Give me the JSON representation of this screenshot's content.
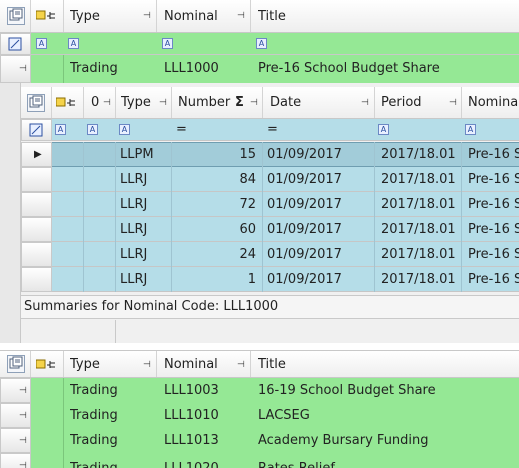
{
  "outer_header": {
    "col_type": "Type",
    "col_nominal": "Nominal",
    "col_title": "Title"
  },
  "filter_icon_letter": "A",
  "group_row": {
    "type": "Trading",
    "nominal": "LLL1000",
    "title": "Pre-16 School Budget Share"
  },
  "inner_header": {
    "col_zero": "0",
    "col_type": "Type",
    "col_number": "Number",
    "sigma": "Σ",
    "col_date": "Date",
    "col_period": "Period",
    "col_nominal": "Nomina"
  },
  "inner_filter_eq": "=",
  "inner_rows": [
    {
      "type": "LLPM",
      "number": "15",
      "date": "01/09/2017",
      "period": "2017/18.01",
      "nominal": "Pre-16 S",
      "current": true
    },
    {
      "type": "LLRJ",
      "number": "84",
      "date": "01/09/2017",
      "period": "2017/18.01",
      "nominal": "Pre-16 S",
      "current": false
    },
    {
      "type": "LLRJ",
      "number": "72",
      "date": "01/09/2017",
      "period": "2017/18.01",
      "nominal": "Pre-16 S",
      "current": false
    },
    {
      "type": "LLRJ",
      "number": "60",
      "date": "01/09/2017",
      "period": "2017/18.01",
      "nominal": "Pre-16 S",
      "current": false
    },
    {
      "type": "LLRJ",
      "number": "24",
      "date": "01/09/2017",
      "period": "2017/18.01",
      "nominal": "Pre-16 S",
      "current": false
    },
    {
      "type": "LLRJ",
      "number": "1",
      "date": "01/09/2017",
      "period": "2017/18.01",
      "nominal": "Pre-16 S",
      "current": false
    }
  ],
  "summary_text": "Summaries for Nominal Code: LLL1000",
  "second_header": {
    "col_type": "Type",
    "col_nominal": "Nominal",
    "col_title": "Title"
  },
  "second_rows": [
    {
      "type": "Trading",
      "nominal": "LLL1003",
      "title": "16-19 School Budget Share"
    },
    {
      "type": "Trading",
      "nominal": "LLL1010",
      "title": "LACSEG"
    },
    {
      "type": "Trading",
      "nominal": "LLL1013",
      "title": "Academy Bursary Funding"
    },
    {
      "type": "Trading",
      "nominal": "LLL1020",
      "title": "Rates Relief"
    }
  ],
  "colors": {
    "group_green": "#95e895",
    "detail_blue": "#b5dde8",
    "current_row": "#a2ccd9"
  },
  "icons": [
    "column-chooser-icon",
    "pin-icon",
    "filter-letter-icon",
    "expand-pin-icon",
    "current-row-arrow-icon",
    "sum-icon",
    "clear-filter-icon"
  ]
}
